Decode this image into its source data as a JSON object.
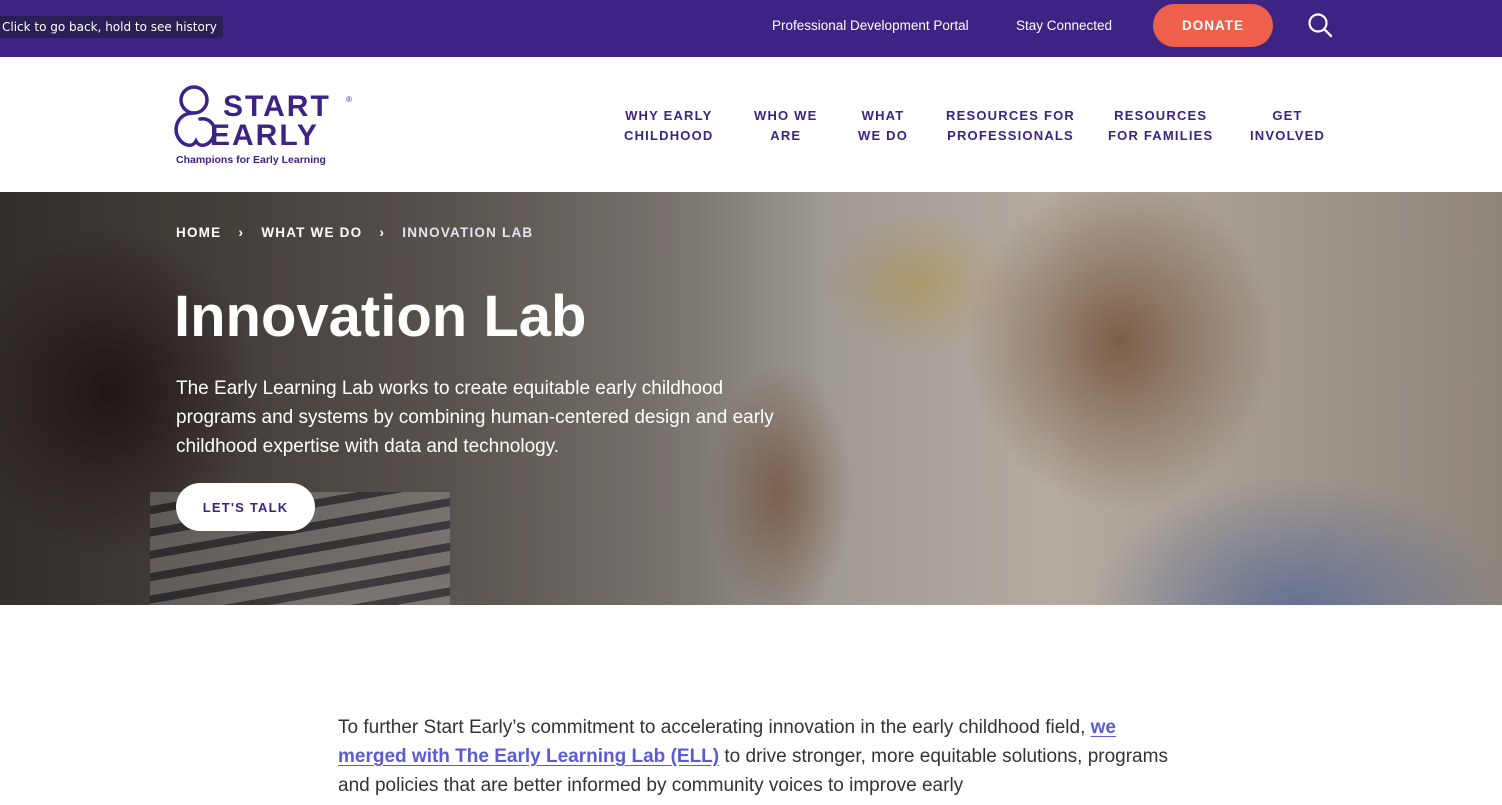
{
  "browser": {
    "tooltip": "Click to go back, hold to see history"
  },
  "utility_nav": {
    "professional_portal": "Professional Development Portal",
    "stay_connected": "Stay Connected",
    "donate": "DONATE",
    "search_icon": "search-icon"
  },
  "logo": {
    "line1": "START",
    "line2": "EARLY",
    "registered": "®",
    "tagline": "Champions for Early Learning"
  },
  "main_nav": [
    {
      "label": "WHY EARLY\nCHILDHOOD"
    },
    {
      "label": "WHO WE\nARE"
    },
    {
      "label": "WHAT\nWE DO"
    },
    {
      "label": "RESOURCES FOR\nPROFESSIONALS"
    },
    {
      "label": "RESOURCES\nFOR FAMILIES"
    },
    {
      "label": "GET\nINVOLVED"
    }
  ],
  "breadcrumb": [
    {
      "label": "HOME"
    },
    {
      "label": "WHAT WE DO"
    },
    {
      "label": "INNOVATION LAB"
    }
  ],
  "breadcrumb_separator": "›",
  "hero": {
    "title": "Innovation Lab",
    "description": "The Early Learning Lab works to create equitable early childhood programs and systems by combining human-centered design and early childhood expertise with data and technology.",
    "cta": "LET'S TALK"
  },
  "intro": {
    "before_link": "To further Start Early’s commitment to accelerating innovation in the early childhood field, ",
    "link": "we merged with The Early Learning Lab (ELL)",
    "after_link": " to drive stronger, more equitable solutions, programs and policies that are better informed by community voices to improve early"
  },
  "colors": {
    "brand_purple": "#3d2384",
    "donate_coral": "#ee5f4c",
    "link_blue": "#5b5bd6"
  }
}
